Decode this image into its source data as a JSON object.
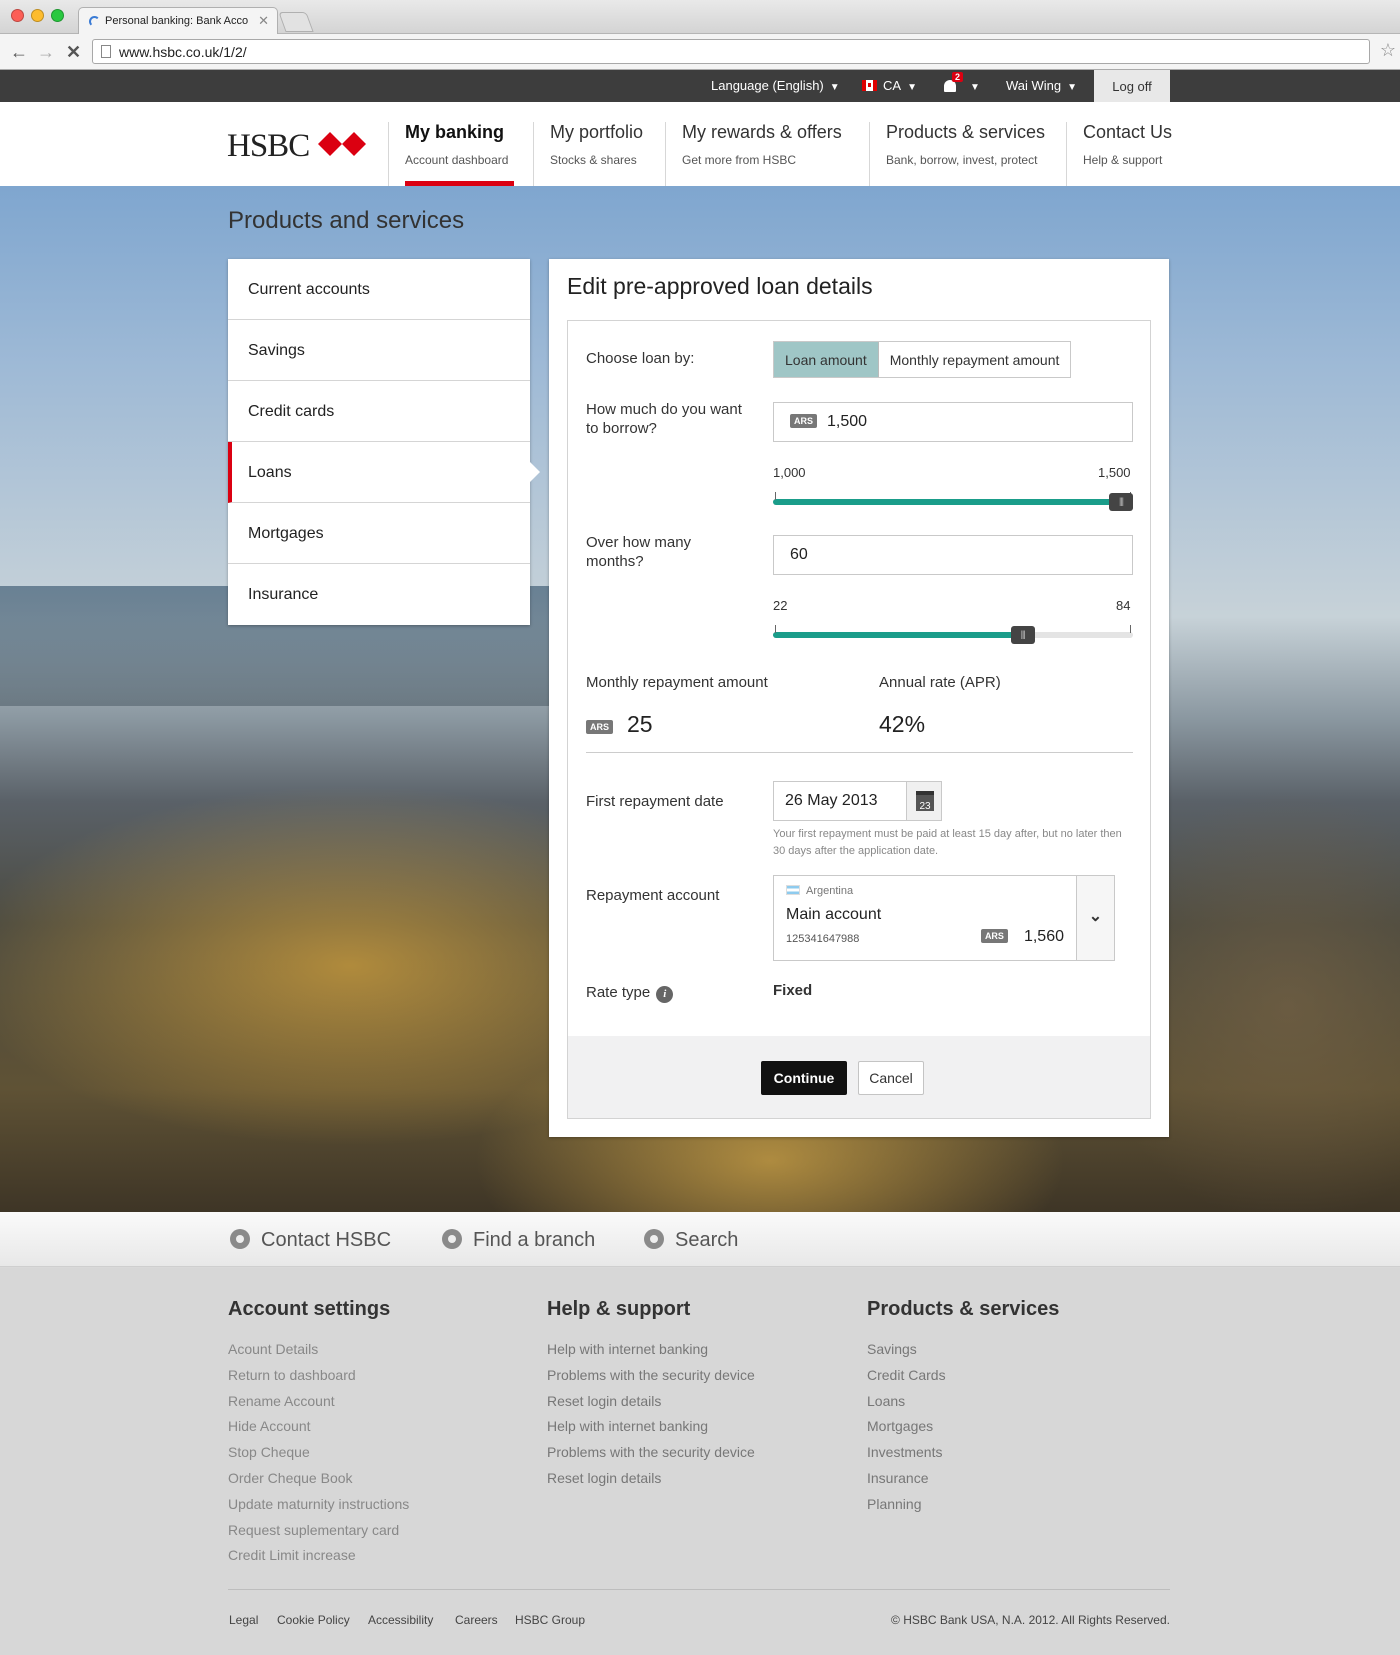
{
  "browser": {
    "tab_title": "Personal banking: Bank Acco",
    "url": "www.hsbc.co.uk/1/2/"
  },
  "utility": {
    "language": "Language (English)",
    "country": "CA",
    "notifications": "2",
    "user": "Wai Wing",
    "logoff": "Log off"
  },
  "header": {
    "logo": "HSBC",
    "nav": [
      {
        "title": "My banking",
        "sub": "Account dashboard"
      },
      {
        "title": "My portfolio",
        "sub": "Stocks & shares"
      },
      {
        "title": "My rewards & offers",
        "sub": "Get more from HSBC"
      },
      {
        "title": "Products & services",
        "sub": "Bank, borrow, invest, protect"
      },
      {
        "title": "Contact Us",
        "sub": "Help & support"
      }
    ]
  },
  "page_title": "Products and services",
  "side_menu": [
    "Current accounts",
    "Savings",
    "Credit cards",
    "Loans",
    "Mortgages",
    "Insurance"
  ],
  "form": {
    "title": "Edit pre-approved loan details",
    "choose_label": "Choose loan by:",
    "choose_options": [
      "Loan amount",
      "Monthly repayment amount"
    ],
    "borrow_label": "How much do you want to borrow?",
    "currency": "ARS",
    "borrow_value": "1,500",
    "borrow_min": "1,000",
    "borrow_max": "1,500",
    "borrow_fraction": 1.0,
    "months_label": "Over how many months?",
    "months_value": "60",
    "months_min": "22",
    "months_max": "84",
    "months_fraction": 0.6935,
    "monthly_label": "Monthly repayment amount",
    "monthly_value": "25",
    "apr_label": "Annual rate (APR)",
    "apr_value": "42%",
    "date_label": "First repayment date",
    "date_value": "26 May 2013",
    "calendar_day": "23",
    "date_help": "Your first repayment must be paid at least  15 day after, but no later then 30 days after the application date.",
    "account_label": "Repayment account",
    "account_country": "Argentina",
    "account_name": "Main account",
    "account_number": "125341647988",
    "account_balance": "1,560",
    "rate_label": "Rate type",
    "rate_value": "Fixed",
    "continue": "Continue",
    "cancel": "Cancel"
  },
  "quick_links": [
    "Contact HSBC",
    "Find a branch",
    "Search"
  ],
  "footer": {
    "columns": [
      {
        "title": "Account settings",
        "links": [
          "Acount Details",
          "Return to dashboard",
          "Rename Account",
          "Hide Account",
          "Stop Cheque",
          "Order Cheque Book",
          "Update maturnity instructions",
          "Request suplementary card",
          "Credit Limit increase"
        ]
      },
      {
        "title": "Help & support",
        "links": [
          "Help with internet banking",
          "Problems with the security device",
          "Reset login details",
          "Help with internet banking",
          "Problems with the security device",
          "Reset login details"
        ]
      },
      {
        "title": "Products & services",
        "links": [
          "Savings",
          "Credit Cards",
          "Loans",
          "Mortgages",
          "Investments",
          "Insurance",
          "Planning"
        ]
      }
    ],
    "legal": [
      "Legal",
      "Cookie Policy",
      "Accessibility",
      "Careers",
      "HSBC Group"
    ],
    "copyright": "© HSBC Bank USA, N.A. 2012. All Rights Reserved."
  },
  "colors": {
    "brand_red": "#db0011",
    "slider_teal": "#1a9d8a",
    "toggle_active": "#9fc6c6"
  }
}
